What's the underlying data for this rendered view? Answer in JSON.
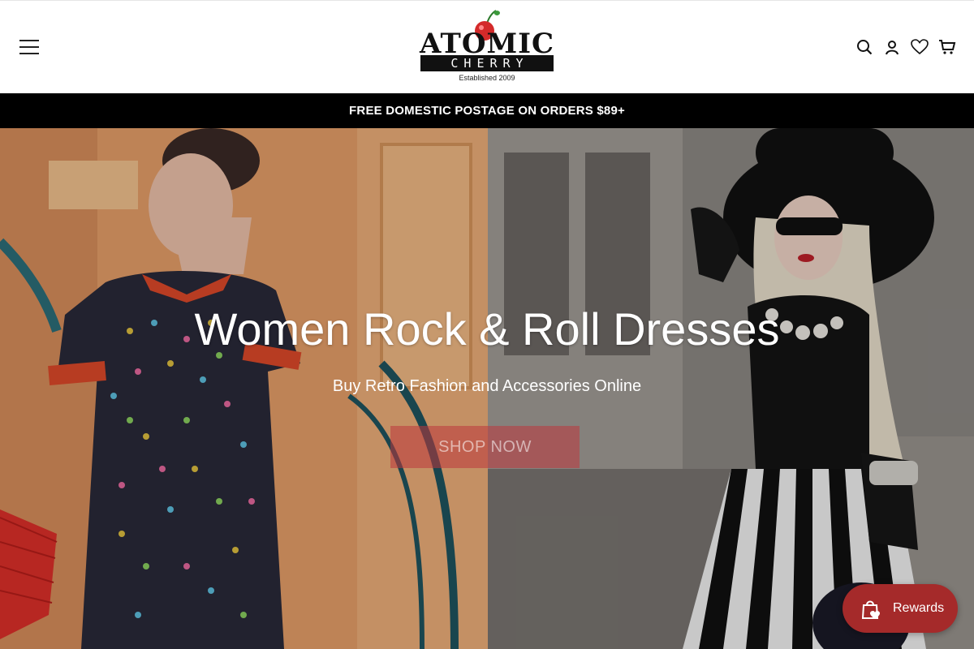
{
  "header": {
    "menu_icon": "hamburger-menu-icon",
    "logo": {
      "line1": "ATOMIC",
      "line2": "CHERRY",
      "tagline": "Established 2009"
    },
    "icons": [
      "search-icon",
      "account-icon",
      "wishlist-heart-icon",
      "cart-icon"
    ]
  },
  "announcement": {
    "text": "FREE DOMESTIC POSTAGE ON ORDERS $89+"
  },
  "hero": {
    "title": "Women Rock & Roll Dresses",
    "subtitle": "Buy Retro Fashion and Accessories Online",
    "button_label": "SHOP NOW"
  },
  "rewards": {
    "label": "Rewards",
    "icon": "gift-bag-heart-icon",
    "color": "#a52a2a"
  },
  "colors": {
    "announcement_bg": "#000000",
    "brand_red": "#d42a2a"
  }
}
